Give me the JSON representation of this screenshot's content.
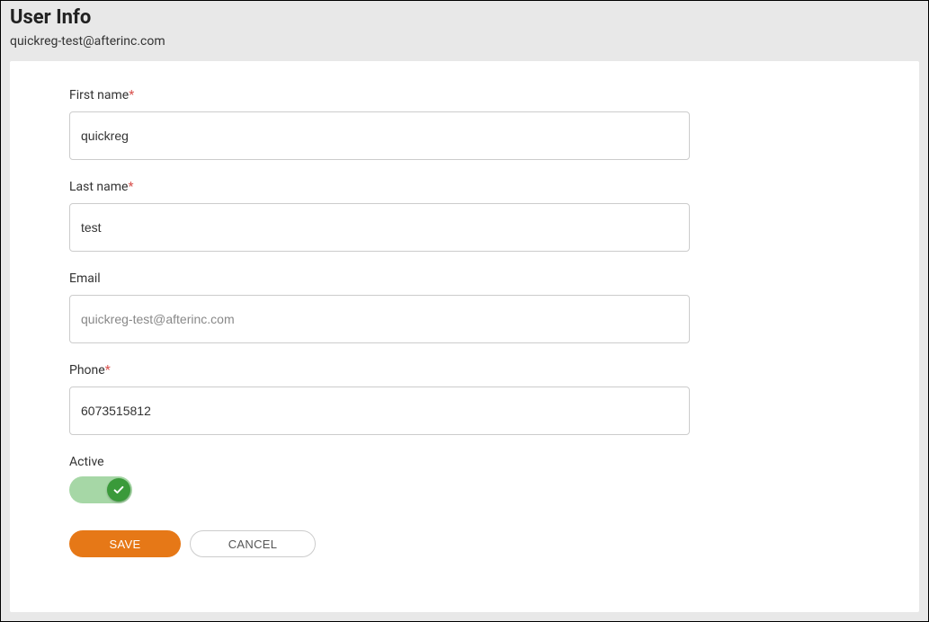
{
  "header": {
    "title": "User Info",
    "subtitle": "quickreg-test@afterinc.com"
  },
  "form": {
    "first_name": {
      "label": "First name",
      "required": true,
      "value": "quickreg"
    },
    "last_name": {
      "label": "Last name",
      "required": true,
      "value": "test"
    },
    "email": {
      "label": "Email",
      "required": false,
      "value": "quickreg-test@afterinc.com"
    },
    "phone": {
      "label": "Phone",
      "required": true,
      "value": "6073515812"
    },
    "active": {
      "label": "Active",
      "value": true
    }
  },
  "buttons": {
    "save": "SAVE",
    "cancel": "CANCEL"
  },
  "colors": {
    "accent": "#e67817",
    "toggle_track": "#a6d7a6",
    "toggle_knob": "#3a9a3a",
    "required": "#d9534f"
  }
}
